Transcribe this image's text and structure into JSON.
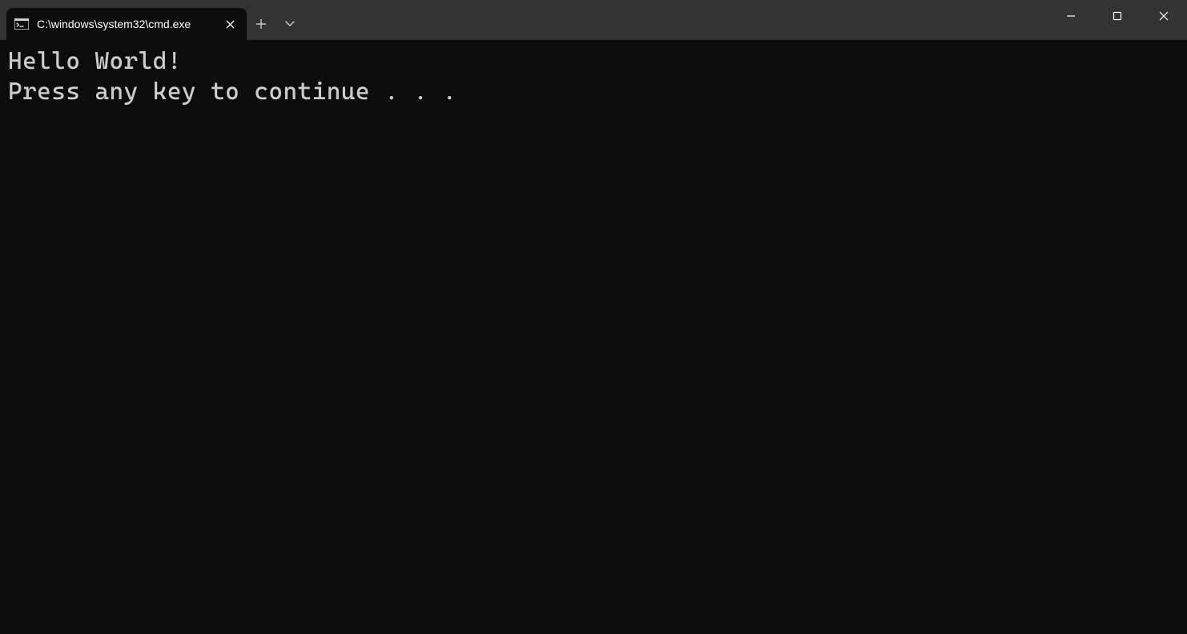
{
  "titlebar": {
    "tab_title": "C:\\windows\\system32\\cmd.exe",
    "tab_icon": "cmd-icon",
    "close_tab_label": "Close tab",
    "new_tab_label": "New tab",
    "dropdown_label": "New tab options"
  },
  "window_controls": {
    "minimize": "Minimize",
    "maximize": "Maximize",
    "close": "Close"
  },
  "terminal": {
    "lines": [
      "Hello World!",
      "Press any key to continue . . ."
    ]
  }
}
